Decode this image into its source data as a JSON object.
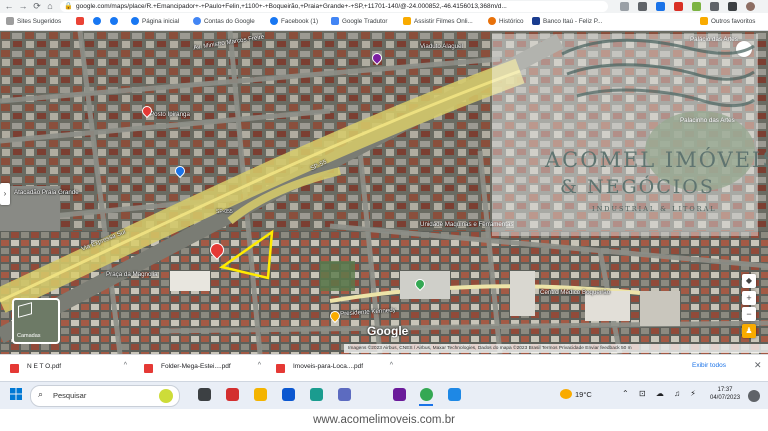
{
  "browser": {
    "url": "google.com/maps/place/R.+Emancipador+-+Paulo+Felin,+1100+-+Boqueirão,+Praia+Grande+-+SP,+11701-140/@-24.000852,-46.4156013,368m/d...",
    "nav": {
      "back": "←",
      "forward": "→",
      "reload": "⟳",
      "home": "⌂"
    },
    "bookmarks": [
      {
        "label": "Sites Sugeridos",
        "color": "#9e9e9e"
      },
      {
        "label": "",
        "color": "#ea4335",
        "icon": "gmail-icon"
      },
      {
        "label": "",
        "color": "#1877f2",
        "icon": "facebook-icon"
      },
      {
        "label": "",
        "color": "#1877f2",
        "icon": "facebook-icon"
      },
      {
        "label": "Página inicial",
        "color": "#1877f2"
      },
      {
        "label": "Contas do Google",
        "color": "#4285f4"
      },
      {
        "label": "Facebook (1)",
        "color": "#1877f2"
      },
      {
        "label": "Google Tradutor",
        "color": "#4285f4"
      },
      {
        "label": "Assistir Filmes Onli...",
        "color": "#f9ab00"
      },
      {
        "label": "Histórico",
        "color": "#e8710a"
      },
      {
        "label": "Banco Itaú - Feliz P...",
        "color": "#1a3c8f"
      },
      {
        "label": "Outros favoritos",
        "color": "#f9ab00"
      }
    ]
  },
  "map": {
    "labels": [
      "Av. Ministro Marcos Freire",
      "Viaduto Alaguel",
      "SP-55",
      "SP-055",
      "Via Expressa Sul",
      "Praça da Magnolia",
      "Unidade Maquinas e Ferramentas",
      "Centro Médico Boqueirão",
      "Av. Presidente Kennedy",
      "Atacadão Praia Grande",
      "Palácio das Artes",
      "Palacinho das Artes",
      "Posto Ipiranga"
    ],
    "watermark": {
      "title": "ACOMEL IMÓVEIS",
      "title2": "& NEGÓCIOS",
      "subtitle": "INDUSTRIAL & LITORAL"
    },
    "layers_label": "Camadas",
    "google_logo": "Google",
    "attribution": "Imagens ©2023 Airbus, CNES / Airbus, Maxar Technologies, Dados do mapa ©2023   Brasil   Termos   Privacidade   Enviar feedback   50 m",
    "controls": {
      "zoom_in": "+",
      "zoom_out": "−"
    }
  },
  "downloads": {
    "items": [
      {
        "name": "N E T O.pdf"
      },
      {
        "name": "Folder-Mega-Estei....pdf"
      },
      {
        "name": "Imoveis-para-Loca....pdf"
      }
    ],
    "show_all": "Exibir todos",
    "close": "✕"
  },
  "taskbar": {
    "search_placeholder": "Pesquisar",
    "weather": "19°C",
    "time": "17:37",
    "date": "04/07/2023",
    "icons": [
      {
        "name": "task-view-icon",
        "color": "#3c4043"
      },
      {
        "name": "adobe-icon",
        "color": "#d32f2f"
      },
      {
        "name": "file-explorer-icon",
        "color": "#f4b400"
      },
      {
        "name": "mail-icon",
        "color": "#0b57d0"
      },
      {
        "name": "edge-icon",
        "color": "#1a9c8f"
      },
      {
        "name": "store-icon",
        "color": "#5c6bc0"
      },
      {
        "name": "app-icon",
        "color": "#6a1b9a"
      },
      {
        "name": "chrome-icon",
        "color": "#34a853"
      },
      {
        "name": "cloud-icon",
        "color": "#1e88e5"
      }
    ]
  },
  "footer": {
    "website": "www.acomelimoveis.com.br"
  }
}
